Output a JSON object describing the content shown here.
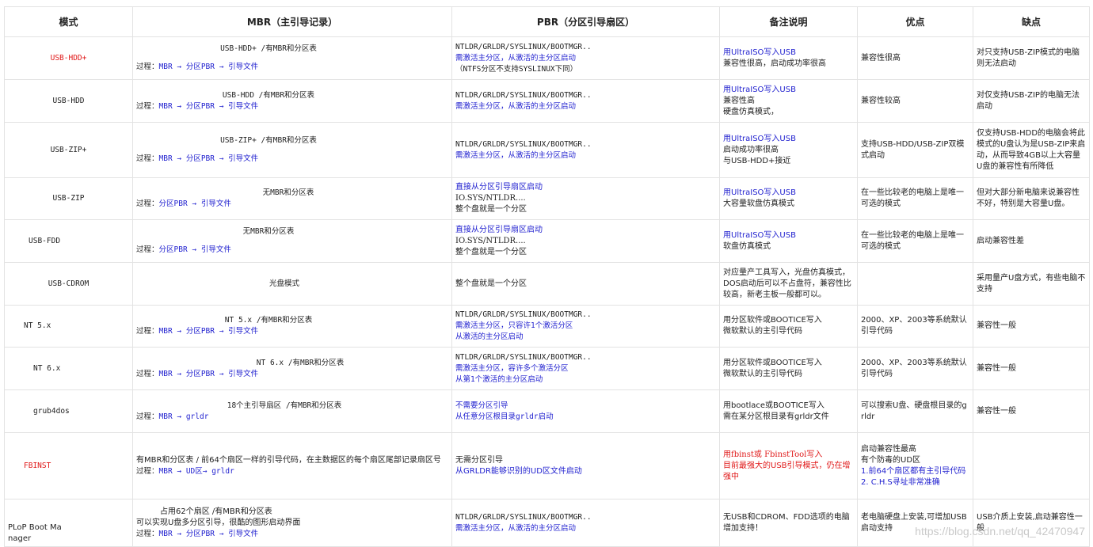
{
  "headers": [
    "模式",
    "MBR（主引导记录）",
    "PBR（分区引导扇区）",
    "备注说明",
    "优点",
    "缺点"
  ],
  "rows": [
    {
      "mode": "USB-HDD+",
      "mbr_title": "USB-HDD+ /有MBR和分区表",
      "mbr_process": "过程：",
      "mbr_flow": "MBR → 分区PBR → 引导文件",
      "pbr_1": "NTLDR/GRLDR/SYSLINUX/BOOTMGR..",
      "pbr_2": "需激活主分区，从激活的主分区启动",
      "pbr_3": "（NTFS分区不支持SYSLINUX下同）",
      "note_1": "用UltraISO写入USB",
      "note_2": "兼容性很高，启动成功率很高",
      "pros": "兼容性很高",
      "cons": "对只支持USB-ZIP模式的电脑则无法启动"
    },
    {
      "mode": "USB-HDD",
      "mbr_title": "USB-HDD /有MBR和分区表",
      "mbr_process": "过程：",
      "mbr_flow": "MBR → 分区PBR → 引导文件",
      "pbr_1": "NTLDR/GRLDR/SYSLINUX/BOOTMGR..",
      "pbr_2": "需激活主分区，从激活的主分区启动",
      "note_1": "用UltraISO写入USB",
      "note_2": "兼容性高",
      "note_3": "硬盘仿真模式，",
      "pros": "兼容性较高",
      "cons": "对仅支持USB-ZIP的电脑无法启动"
    },
    {
      "mode": "USB-ZIP+",
      "mbr_title": "USB-ZIP+ /有MBR和分区表",
      "mbr_process": "过程：",
      "mbr_flow": "MBR → 分区PBR → 引导文件",
      "pbr_1": "NTLDR/GRLDR/SYSLINUX/BOOTMGR..",
      "pbr_2": "需激活主分区，从激活的主分区启动",
      "note_1": "用UltraISO写入USB",
      "note_2": "启动成功率很高",
      "note_3": "与USB-HDD+接近",
      "pros": "支持USB-HDD/USB-ZIP双模式启动",
      "cons": "仅支持USB-HDD的电脑会将此模式的U盘认为是USB-ZIP来启动，从而导致4GB以上大容量U盘的兼容性有所降低"
    },
    {
      "mode": "USB-ZIP",
      "mbr_title": "无MBR和分区表",
      "mbr_process": "过程：",
      "mbr_flow": "分区PBR → 引导文件",
      "pbr_1": "直接从分区引导扇区启动",
      "pbr_2": "IO.SYS/NTLDR....",
      "pbr_3": "整个盘就是一个分区",
      "note_1": "用UltraISO写入USB",
      "note_2": "大容量软盘仿真模式",
      "pros": "在一些比较老的电脑上是唯一可选的模式",
      "cons": "但对大部分新电脑来说兼容性不好，特别是大容量U盘。"
    },
    {
      "mode": "USB-FDD",
      "mbr_title": "无MBR和分区表",
      "mbr_process": "过程：",
      "mbr_flow": "分区PBR → 引导文件",
      "pbr_1": "直接从分区引导扇区启动",
      "pbr_2": "IO.SYS/NTLDR....",
      "pbr_3": "整个盘就是一个分区",
      "note_1": "用UltraISO写入USB",
      "note_2": "软盘仿真模式",
      "pros": "在一些比较老的电脑上是唯一可选的模式",
      "cons": "启动兼容性差"
    },
    {
      "mode": "USB-CDROM",
      "mbr_title": "光盘模式",
      "pbr_1": "整个盘就是一个分区",
      "note_1": "对应量产工具写入，光盘仿真模式，DOS启动后可以不占盘符，兼容性比较高，新老主板一般都可以。",
      "pros": "",
      "cons": "采用量产U盘方式，有些电脑不支持"
    },
    {
      "mode": "NT 5.x",
      "mbr_title": "NT 5.x /有MBR和分区表",
      "mbr_process": "过程：",
      "mbr_flow": "MBR → 分区PBR → 引导文件",
      "pbr_1": "NTLDR/GRLDR/SYSLINUX/BOOTMGR..",
      "pbr_2": "需激活主分区，只容许1个激活分区",
      "pbr_3": "从激活的主分区启动",
      "note_1": "用分区软件或BOOTICE写入",
      "note_2": "微软默认的主引导代码",
      "pros": "2000、XP、2003等系统默认引导代码",
      "cons": "兼容性一般"
    },
    {
      "mode": "NT 6.x",
      "mbr_title": "NT 6.x /有MBR和分区表",
      "mbr_process": "过程：",
      "mbr_flow": "MBR → 分区PBR → 引导文件",
      "pbr_1": "NTLDR/GRLDR/SYSLINUX/BOOTMGR..",
      "pbr_2": "需激活主分区，容许多个激活分区",
      "pbr_3": "从第1个激活的主分区启动",
      "note_1": "用分区软件或BOOTICE写入",
      "note_2": "微软默认的主引导代码",
      "pros": "2000、XP、2003等系统默认引导代码",
      "cons": "兼容性一般"
    },
    {
      "mode": "grub4dos",
      "mbr_title": "18个主引导扇区 /有MBR和分区表",
      "mbr_process": "过程：",
      "mbr_flow": "MBR  → grldr",
      "pbr_1": "不需要分区引导",
      "pbr_2": "从任意分区根目录grldr启动",
      "note_1": "用bootlace或BOOTICE写入",
      "note_2": "需在某分区根目录有grldr文件",
      "pros": "可以搜索U盘、硬盘根目录的grldr",
      "cons": "兼容性一般"
    },
    {
      "mode": "FBINST",
      "mbr_title": "有MBR和分区表 / 前64个扇区一样的引导代码，在主数据区的每个扇区尾部记录扇区号",
      "mbr_process": "过程：",
      "mbr_flow": "MBR → UD区→ grldr",
      "pbr_1": "无需分区引导",
      "pbr_2": "从GRLDR能够识别的UD区文件启动",
      "note_1": "用fbinst或 FbinstTool写入",
      "note_2": "目前最强大的USB引导模式，仍在增强中",
      "pros_1": "启动兼容性最高",
      "pros_2": "有个防毒的UD区",
      "pros_3": "1.前64个扇区都有主引导代码",
      "pros_4": "2. C.H.S寻址非常准确",
      "cons": ""
    },
    {
      "mode": "PLoP Boot Manager",
      "mbr_title": "占用62个扇区 /有MBR和分区表",
      "mbr_sub": "可以实现U盘多分区引导，很酷的图形启动界面",
      "mbr_process": "过程：",
      "mbr_flow": "MBR → 分区PBR → 引导文件",
      "pbr_1": "NTLDR/GRLDR/SYSLINUX/BOOTMGR..",
      "pbr_2": "需激活主分区，从激活的主分区启动",
      "note_1": "无USB和CDROM、FDD选项的电脑增加支持！",
      "pros": "老电脑硬盘上安装,可增加USB启动支持",
      "cons": "USB介质上安装,启动兼容性一般"
    }
  ],
  "watermark": "https://blog.csdn.net/qq_42470947"
}
